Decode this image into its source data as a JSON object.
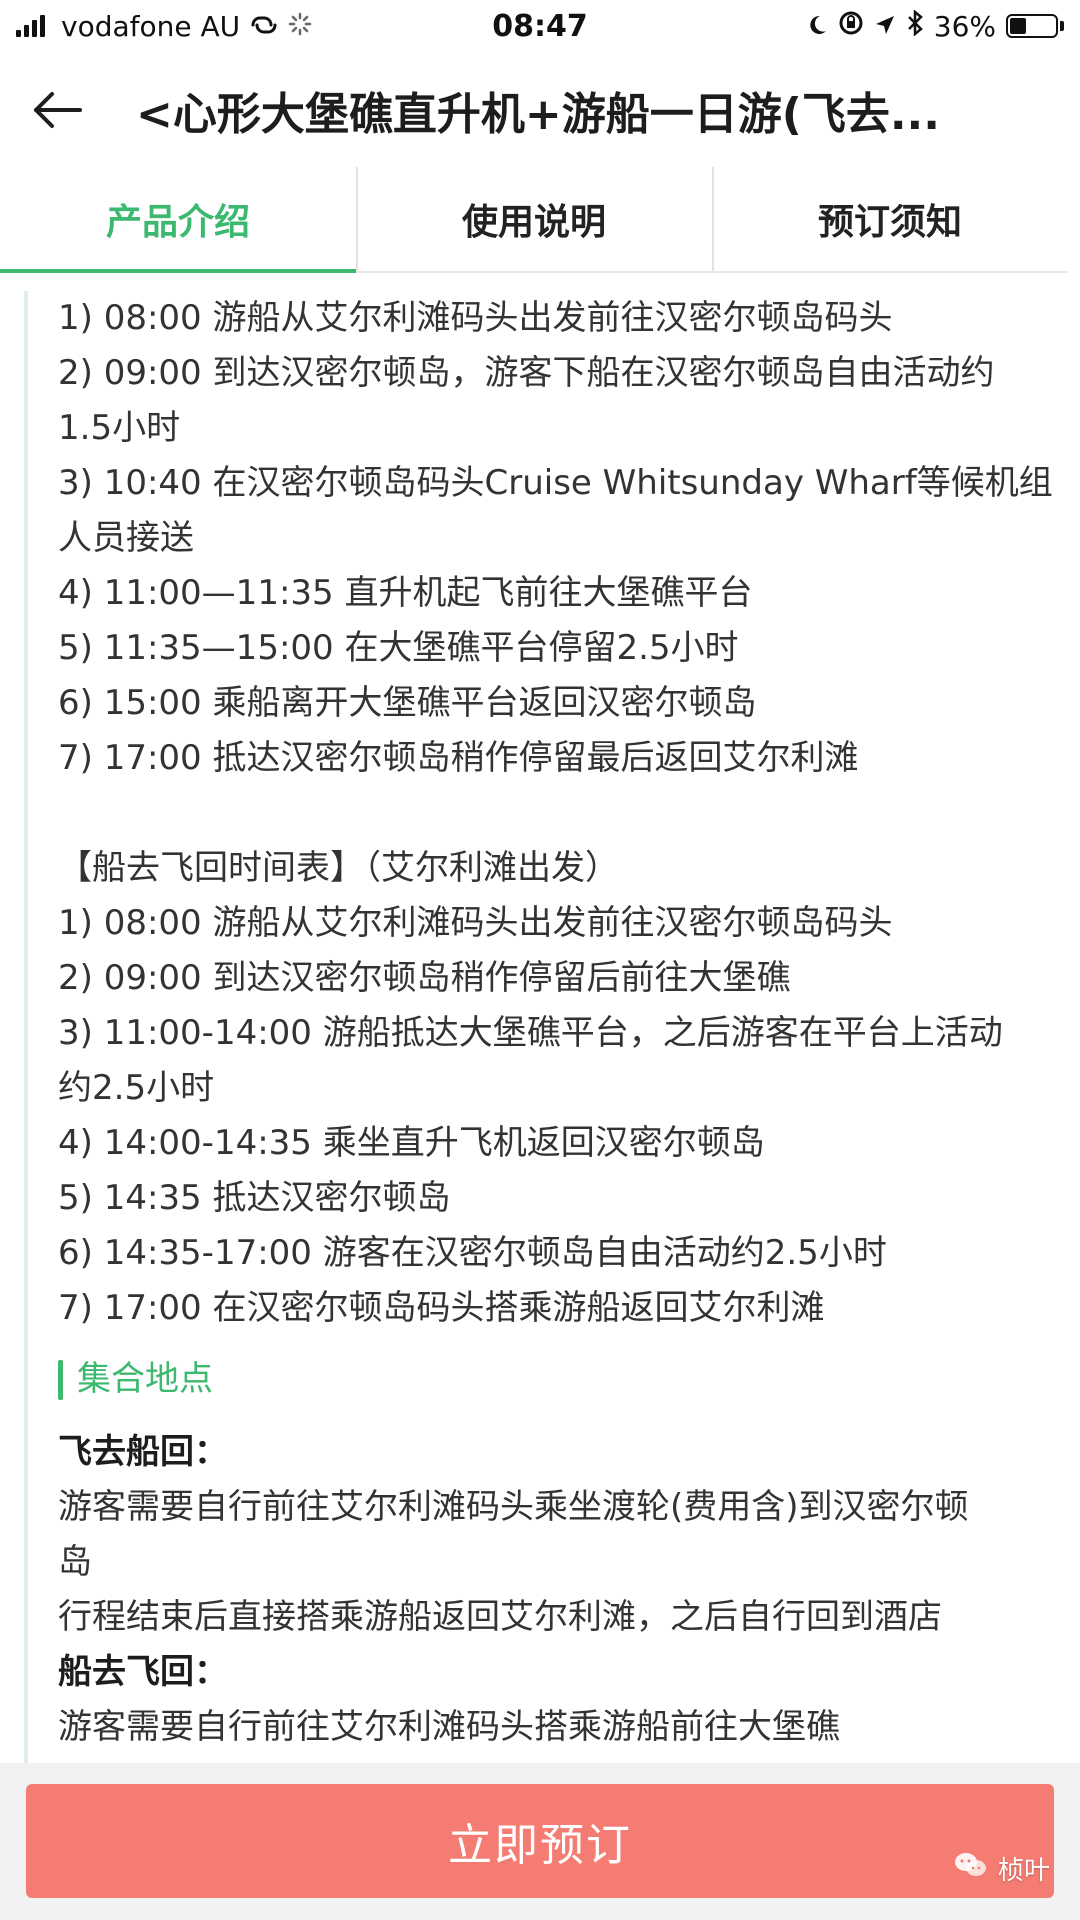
{
  "status_bar": {
    "carrier": "vodafone AU",
    "time": "08:47",
    "battery": "36%",
    "battery_level": 0.36
  },
  "header": {
    "title": "<心形大堡礁直升机+游船一日游(飞去..."
  },
  "tabs": [
    {
      "label": "产品介绍",
      "active": true
    },
    {
      "label": "使用说明",
      "active": false
    },
    {
      "label": "预订须知",
      "active": false
    }
  ],
  "content": {
    "schedule1": [
      "1) 08:00 游船从艾尔利滩码头出发前往汉密尔顿岛码头",
      "2) 09:00 到达汉密尔顿岛，游客下船在汉密尔顿岛自由活动约",
      "1.5小时",
      "3) 10:40 在汉密尔顿岛码头Cruise Whitsunday Wharf等候机组",
      "人员接送",
      "4) 11:00—11:35 直升机起飞前往大堡礁平台",
      "5) 11:35—15:00 在大堡礁平台停留2.5小时",
      "6) 15:00 乘船离开大堡礁平台返回汉密尔顿岛",
      "7) 17:00 抵达汉密尔顿岛稍作停留最后返回艾尔利滩"
    ],
    "schedule2_title": "【船去飞回时间表】（艾尔利滩出发）",
    "schedule2": [
      "1) 08:00 游船从艾尔利滩码头出发前往汉密尔顿岛码头",
      "2) 09:00 到达汉密尔顿岛稍作停留后前往大堡礁",
      "3) 11:00-14:00 游船抵达大堡礁平台，之后游客在平台上活动",
      "约2.5小时",
      "4) 14:00-14:35 乘坐直升飞机返回汉密尔顿岛",
      "5) 14:35 抵达汉密尔顿岛",
      "6) 14:35-17:00 游客在汉密尔顿岛自由活动约2.5小时",
      "7) 17:00 在汉密尔顿岛码头搭乘游船返回艾尔利滩"
    ],
    "meeting_point_title": "集合地点",
    "fly_boat_title": "飞去船回：",
    "fly_boat_lines": [
      "游客需要自行前往艾尔利滩码头乘坐渡轮(费用含)到汉密尔顿",
      "岛",
      "行程结束后直接搭乘游船返回艾尔利滩，之后自行回到酒店"
    ],
    "boat_fly_title": "船去飞回：",
    "boat_fly_lines": [
      "游客需要自行前往艾尔利滩码头搭乘游船前往大堡礁"
    ]
  },
  "bottom": {
    "book_now": "立即预订",
    "watermark": "桢叶"
  },
  "colors": {
    "accent": "#3cb86f",
    "button": "#f47c72"
  }
}
